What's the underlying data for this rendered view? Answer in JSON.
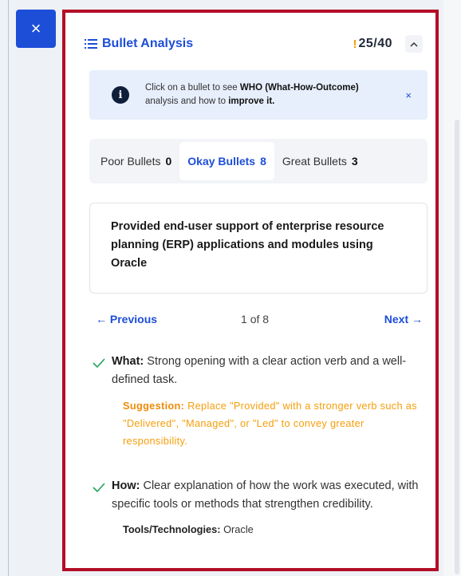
{
  "close_button": "×",
  "header": {
    "title": "Bullet Analysis",
    "warning": "!",
    "score": "25/40",
    "collapse": "^"
  },
  "info": {
    "pre": "Click on a bullet to see ",
    "who": "WHO (What-How-Outcome)",
    "mid": " analysis and how to ",
    "improve": "improve it.",
    "close": "×"
  },
  "tabs": [
    {
      "label": "Poor Bullets",
      "count": "0"
    },
    {
      "label": "Okay Bullets",
      "count": "8"
    },
    {
      "label": "Great Bullets",
      "count": "3"
    }
  ],
  "bullet_text": "Provided end-user support of enterprise resource planning (ERP) applications and modules using Oracle",
  "pager": {
    "prev": "← Previous",
    "page": "1 of 8",
    "next": "Next →"
  },
  "feedback": {
    "what_label": "What:",
    "what_text": " Strong opening with a clear action verb and a well-defined task.",
    "suggestion_label": "Suggestion:",
    "suggestion_text": " Replace \"Provided\" with a stronger verb such as \"Delivered\", \"Managed\", or \"Led\" to convey greater responsibility.",
    "how_label": "How:",
    "how_text": " Clear explanation of how the work was executed, with specific tools or methods that strengthen credibility.",
    "tools_label": "Tools/Technologies:",
    "tools_text": " Oracle"
  },
  "colors": {
    "accent": "#1d4ed8",
    "border": "#b30d28",
    "warning": "#f59e0b",
    "check": "#22a35a"
  }
}
